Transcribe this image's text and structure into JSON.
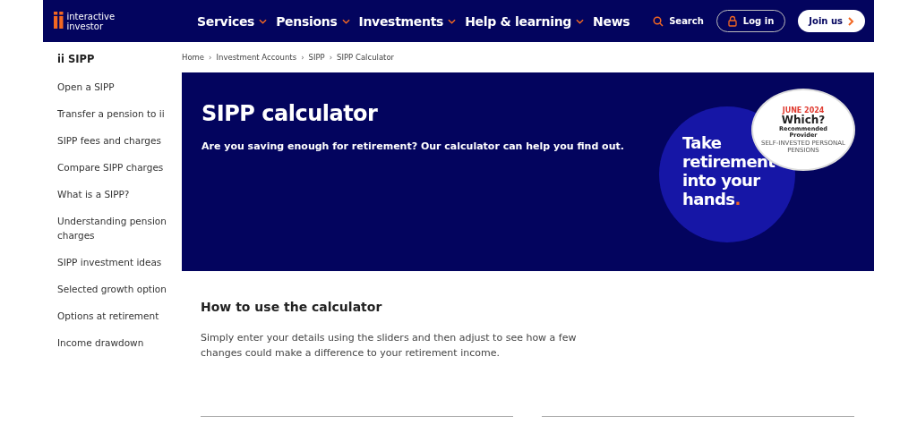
{
  "header": {
    "logo": {
      "mark": "ii",
      "line1": "interactive",
      "line2": "investor"
    },
    "nav": [
      {
        "label": "Services",
        "dropdown": true
      },
      {
        "label": "Pensions",
        "dropdown": true
      },
      {
        "label": "Investments",
        "dropdown": true
      },
      {
        "label": "Help & learning",
        "dropdown": true
      },
      {
        "label": "News",
        "dropdown": false
      }
    ],
    "search": "Search",
    "login": "Log in",
    "join": "Join us"
  },
  "sidebar": {
    "title": "ii SIPP",
    "items": [
      "Open a SIPP",
      "Transfer a pension to ii",
      "SIPP fees and charges",
      "Compare SIPP charges",
      "What is a SIPP?",
      "Understanding pension charges",
      "SIPP investment ideas",
      "Selected growth option",
      "Options at retirement",
      "Income drawdown"
    ]
  },
  "breadcrumb": {
    "separator": "›",
    "items": [
      "Home",
      "Investment Accounts",
      "SIPP",
      "SIPP Calculator"
    ]
  },
  "hero": {
    "title": "SIPP calculator",
    "subtitle": "Are you saving enough for retirement? Our calculator can help you find out.",
    "promo": [
      "Take",
      "retirement",
      "into your",
      "hands"
    ],
    "promo_dot": ".",
    "badge": {
      "date": "JUNE 2024",
      "brand": "Which?",
      "line1": "Recommended",
      "line2": "Provider",
      "ring": "SELF-INVESTED PERSONAL PENSIONS"
    }
  },
  "howto": {
    "title": "How to use the calculator",
    "text": "Simply enter your details using the sliders and then adjust to see how a few changes could make a difference to your retirement income."
  }
}
